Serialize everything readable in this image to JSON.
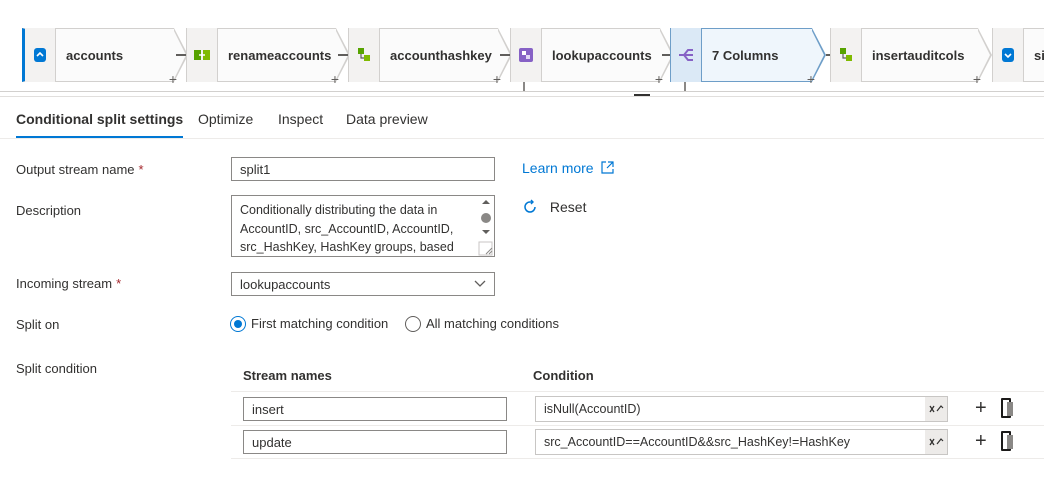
{
  "pipeline": {
    "nodes": [
      {
        "label": "accounts",
        "icon": "source-icon"
      },
      {
        "label": "renameaccounts",
        "icon": "select-icon"
      },
      {
        "label": "accounthashkey",
        "icon": "derived-column-icon"
      },
      {
        "label": "lookupaccounts",
        "icon": "lookup-icon"
      },
      {
        "label": "7 Columns",
        "icon": "conditional-split-icon"
      },
      {
        "label": "insertauditcols",
        "icon": "derived-column-icon"
      },
      {
        "label": "sin",
        "icon": "sink-icon"
      }
    ],
    "plus": "+"
  },
  "tabs": [
    {
      "label": "Conditional split settings",
      "active": true
    },
    {
      "label": "Optimize",
      "active": false
    },
    {
      "label": "Inspect",
      "active": false
    },
    {
      "label": "Data preview",
      "active": false
    }
  ],
  "form": {
    "output_stream_label": "Output stream name",
    "output_stream_value": "split1",
    "required_mark": "*",
    "learn_more": "Learn more",
    "description_label": "Description",
    "description_value": "Conditionally distributing the data in AccountID, src_AccountID, AccountID, src_HashKey, HashKey groups, based on",
    "reset": "Reset",
    "incoming_label": "Incoming stream",
    "incoming_value": "lookupaccounts",
    "split_on_label": "Split on",
    "split_on_options": [
      "First matching condition",
      "All matching conditions"
    ],
    "split_on_selected": 0,
    "split_condition_label": "Split condition"
  },
  "conditions": {
    "headers": {
      "stream": "Stream names",
      "condition": "Condition"
    },
    "rows": [
      {
        "stream": "insert",
        "condition": "isNull(AccountID)"
      },
      {
        "stream": "update",
        "condition": "src_AccountID==AccountID&&src_HashKey!=HashKey"
      }
    ],
    "add_symbol": "+"
  },
  "colors": {
    "accent": "#0078d4",
    "selected_node": "#eff6fc",
    "required": "#a4262c"
  }
}
